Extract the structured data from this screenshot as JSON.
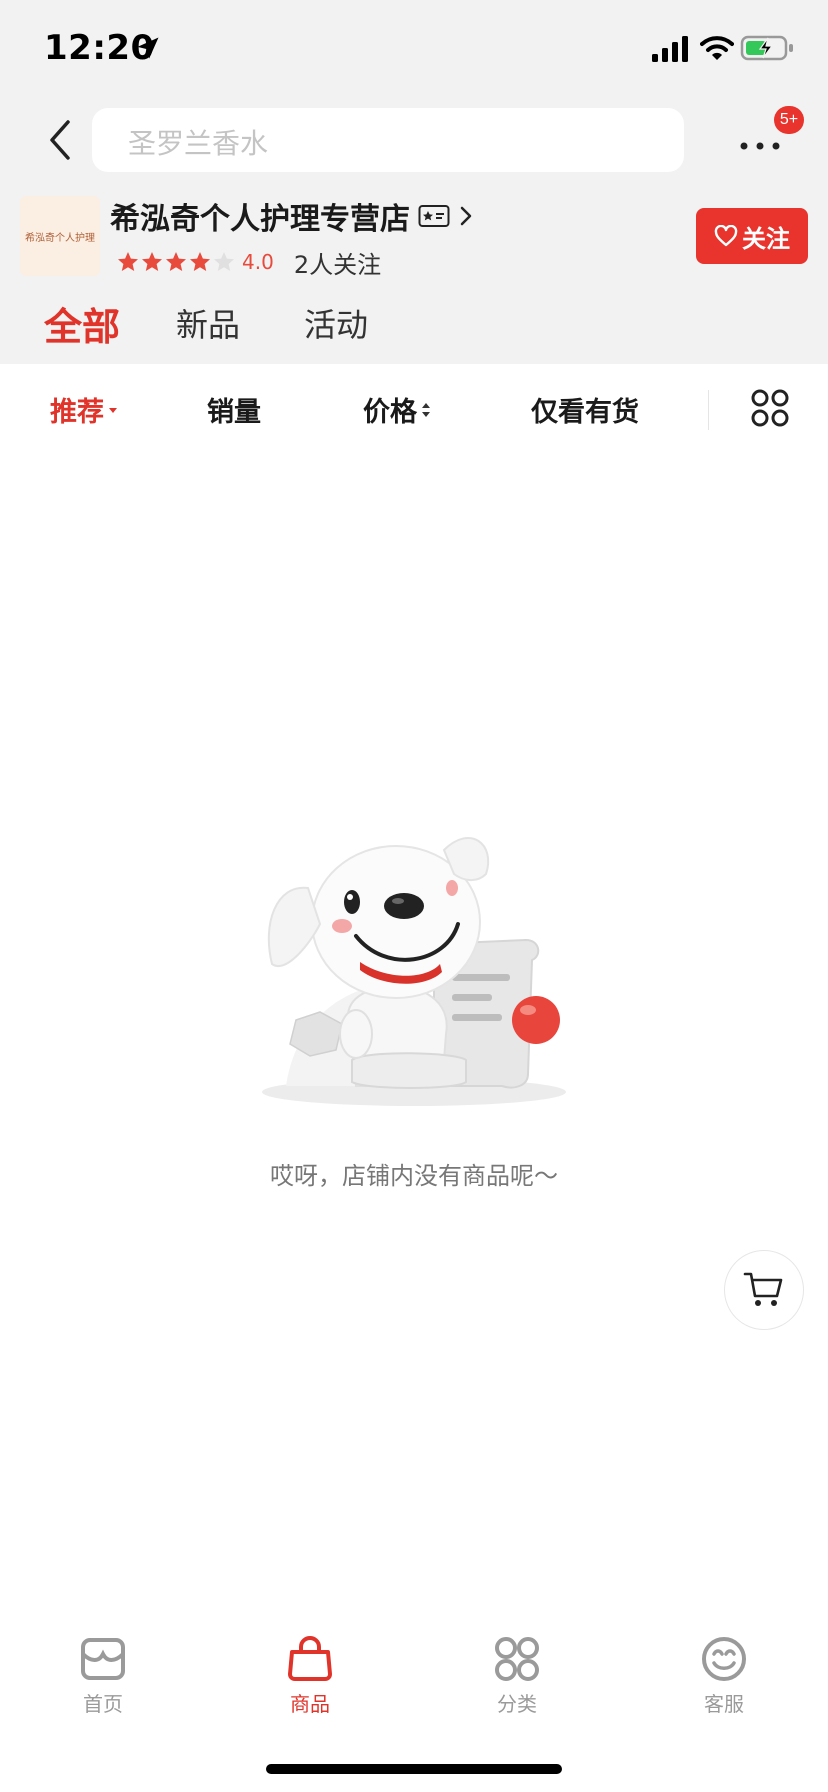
{
  "status_bar": {
    "time": "12:20"
  },
  "nav": {
    "search_placeholder": "圣罗兰香水",
    "more_badge": "5+"
  },
  "shop": {
    "logo_text": "希泓奇个人护理",
    "name": "希泓奇个人护理专营店",
    "rating_value": "4.0",
    "rating_stars": 4,
    "followers": "2人关注",
    "follow_label": "关注"
  },
  "tabs": [
    {
      "label": "全部",
      "active": true
    },
    {
      "label": "新品",
      "active": false
    },
    {
      "label": "活动",
      "active": false
    }
  ],
  "sort_bar": {
    "items": [
      {
        "label": "推荐",
        "active": true
      },
      {
        "label": "销量",
        "active": false
      },
      {
        "label": "价格",
        "active": false
      },
      {
        "label": "仅看有货",
        "active": false
      }
    ]
  },
  "empty_state": {
    "message": "哎呀，店铺内没有商品呢～"
  },
  "bottom_nav": [
    {
      "label": "首页",
      "icon": "store-icon",
      "active": false
    },
    {
      "label": "商品",
      "icon": "bag-icon",
      "active": true
    },
    {
      "label": "分类",
      "icon": "category-icon",
      "active": false
    },
    {
      "label": "客服",
      "icon": "service-icon",
      "active": false
    }
  ],
  "colors": {
    "accent": "#e0342b",
    "background_top": "#f2f2f2",
    "muted_text": "#9a9a9a"
  }
}
